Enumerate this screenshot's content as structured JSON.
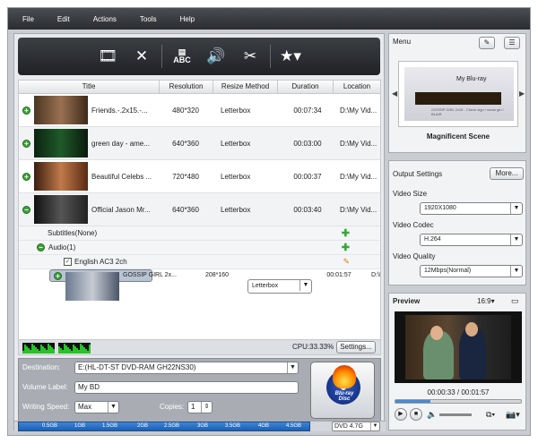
{
  "menu": [
    "File",
    "Edit",
    "Actions",
    "Tools",
    "Help"
  ],
  "toolbar": {
    "abc_label": "ABC"
  },
  "columns": [
    "Title",
    "Resolution",
    "Resize Method",
    "Duration",
    "Location"
  ],
  "rows": [
    {
      "title": "Friends.-.2x15.-...",
      "res": "480*320",
      "rm": "Letterbox",
      "dur": "00:07:34",
      "loc": "D:\\My Vid..."
    },
    {
      "title": "green day - ame...",
      "res": "640*360",
      "rm": "Letterbox",
      "dur": "00:03:00",
      "loc": "D:\\My Vid..."
    },
    {
      "title": "Beautiful Celebs ...",
      "res": "720*480",
      "rm": "Letterbox",
      "dur": "00:00:37",
      "loc": "D:\\My Vid..."
    },
    {
      "title": "Official Jason Mr...",
      "res": "640*360",
      "rm": "Letterbox",
      "dur": "00:03:40",
      "loc": "D:\\My Vid..."
    },
    {
      "title": "GOSSIP GIRL 2x...",
      "res": "208*160",
      "rm": "Letterbox",
      "dur": "00:01:57",
      "loc": "D:\\My Vid..."
    }
  ],
  "subitems": {
    "subtitles": "Subtitles(None)",
    "audio": "Audio(1)",
    "track": "English AC3 2ch"
  },
  "status": {
    "cpu": "CPU:33.33%",
    "settings": "Settings..."
  },
  "destination": {
    "dest_label": "Destination:",
    "dest_value": "E:(HL-DT-ST DVD-RAM GH22NS30)",
    "vol_label": "Volume Label:",
    "vol_value": "My BD",
    "speed_label": "Writing Speed:",
    "speed_value": "Max",
    "copies_label": "Copies:",
    "copies_value": "1",
    "burn_text": "Blu-ray Disc"
  },
  "capacity": {
    "ticks": [
      "0.5GB",
      "1GB",
      "1.5GB",
      "2GB",
      "2.5GB",
      "3GB",
      "3.5GB",
      "4GB",
      "4.5GB"
    ],
    "disc": "DVD 4.7G"
  },
  "menu_panel": {
    "title": "Menu",
    "preview_title": "My Blu-ray",
    "preview_sub": "GOSSIP GIRL 2x15 - Check sign / mean girl / BLAIR",
    "scene": "Magnificent Scene"
  },
  "output": {
    "title": "Output Settings",
    "more": "More...",
    "size_label": "Video Size",
    "size": "1920X1080",
    "codec_label": "Video Codec",
    "codec": "H.264",
    "quality_label": "Video Quality",
    "quality": "12Mbps(Normal)"
  },
  "preview": {
    "title": "Preview",
    "aspect": "16:9▾",
    "time": "00:00:33 / 00:01:57",
    "progress": 0.28
  }
}
